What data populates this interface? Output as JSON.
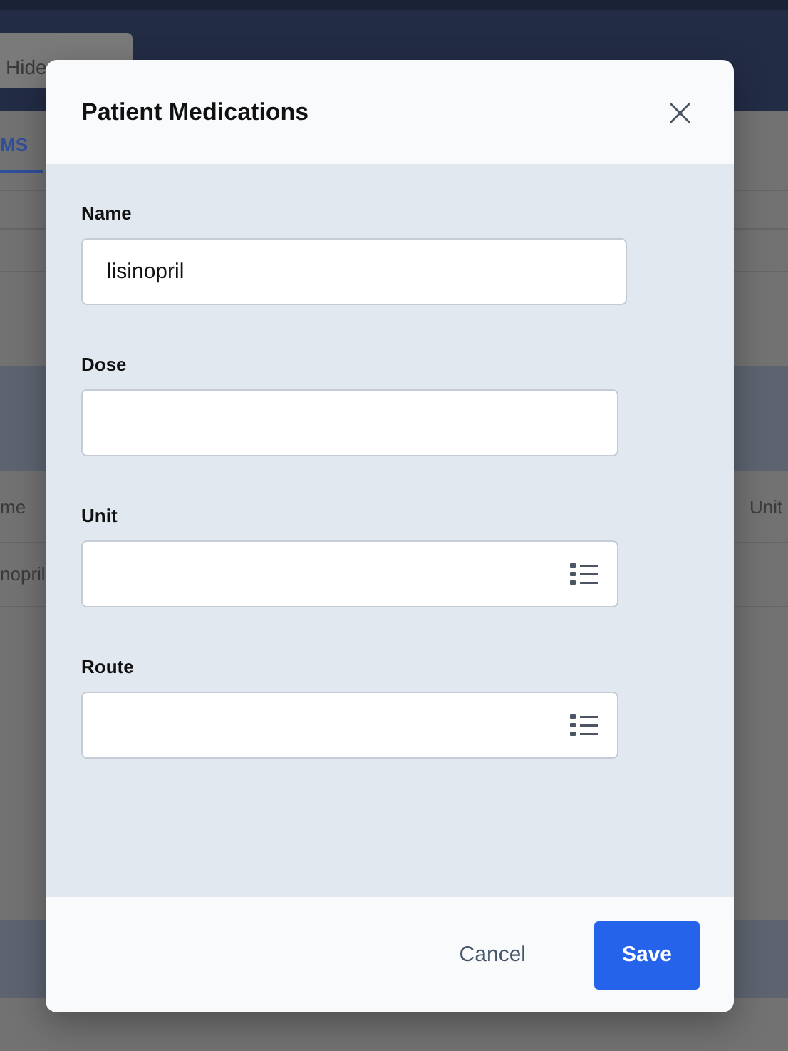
{
  "background": {
    "hide_rules_button": "Hide",
    "tab": {
      "label": "MS",
      "selected": true
    },
    "table": {
      "header": [
        "me",
        "Unit"
      ],
      "row": [
        "nopril"
      ]
    }
  },
  "dialog": {
    "title": "Patient Medications",
    "close": "×",
    "fields": [
      {
        "label": "Name",
        "value": "lisinopril",
        "kind": "text"
      },
      {
        "label": "Dose",
        "kind": "text"
      },
      {
        "label": "Unit",
        "kind": "picker"
      },
      {
        "label": "Route",
        "kind": "picker"
      }
    ],
    "buttons": [
      {
        "label": "Cancel",
        "kind": "secondary"
      },
      {
        "label": "Save",
        "kind": "primary"
      }
    ]
  }
}
